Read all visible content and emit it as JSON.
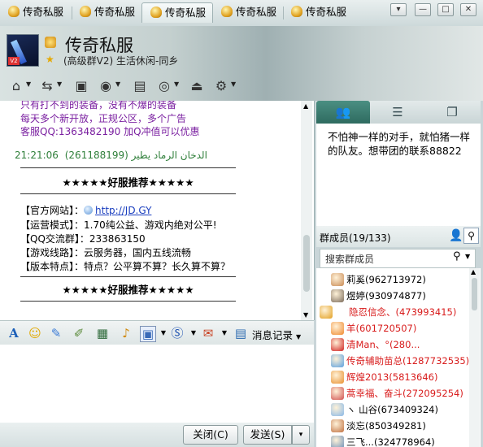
{
  "tabs": [
    {
      "label": "传奇私服",
      "active": false
    },
    {
      "label": "传奇私服",
      "active": false
    },
    {
      "label": "传奇私服",
      "active": true
    },
    {
      "label": "传奇私服",
      "active": false
    },
    {
      "label": "传奇私服",
      "active": false
    }
  ],
  "window": {
    "dropdown": "▾",
    "minimize": "—",
    "maximize": "□",
    "close": "✕"
  },
  "group": {
    "title": "传奇私服",
    "subtitle": "(高级群V2) 生活休闲-同乡",
    "avatar_badge": "V2"
  },
  "toolbar_icons": [
    "home-icon",
    "share-icon",
    "save-icon",
    "mic-icon",
    "board-icon",
    "webcam-icon",
    "shortcut-icon",
    "settings-icon"
  ],
  "chat": {
    "promo_lines": [
      "只有打不到的装备，没有不爆的装备",
      "每天多个新开放，正规公区，多个广告",
      "客服QQ:1363482190   加Q冲值可以优惠"
    ],
    "sender_name": "الدخان الرماد يطير",
    "sender_id": "(261188199)",
    "sender_time": "21:21:06",
    "banner": "★★★★★好服推荐★★★★★",
    "info": [
      {
        "label": "【官方网站】：",
        "value": "http://JD.GY",
        "link": true
      },
      {
        "label": "【运营模式】：",
        "value": "1.70纯公益、游戏内绝对公平!",
        "link": false
      },
      {
        "label": "【QQ交流群】：",
        "value": "233863150",
        "link": false
      },
      {
        "label": "【游戏线路】：",
        "value": "云服务器，国内五线流畅",
        "link": false
      },
      {
        "label": "【版本特点】：",
        "value": "特点？公平算不算？长久算不算？",
        "link": false
      }
    ],
    "banner2": "★★★★★好服推荐★★★★★"
  },
  "input_toolbar": {
    "msg_log": "消息记录"
  },
  "buttons": {
    "close": "关闭(C)",
    "send": "发送(S)",
    "send_arrow": "▾"
  },
  "right_tabs": [
    "members-tab",
    "list-tab",
    "window-tab"
  ],
  "notice": "不怕神一样的对手，就怕猪一样的队友。想带团的联系88822",
  "members": {
    "header": "群成员(19/133)",
    "search_placeholder": "搜索群成员",
    "list": [
      {
        "name": "莉奚(962713972)",
        "red": false,
        "av": "#c98a54"
      },
      {
        "name": "煜婷(930974877)",
        "red": false,
        "av": "#7a6a5a"
      },
      {
        "name": "隐忍信念、(473993415)",
        "red": true,
        "av": "#e2a020"
      },
      {
        "name": "羊(601720507)",
        "red": true,
        "av": "#f08a30"
      },
      {
        "name": "清Man、°(280...",
        "red": true,
        "av": "#d02020"
      },
      {
        "name": "传奇辅助苗总(1287732535)",
        "red": true,
        "av": "#5aa0e0"
      },
      {
        "name": "辉煌2013(5813646)",
        "red": true,
        "av": "#e89030"
      },
      {
        "name": "蒿幸福、奋斗(272095254)",
        "red": true,
        "av": "#d05050"
      },
      {
        "name": "ヽ 山谷(673409324)",
        "red": false,
        "av": "#88b8e8"
      },
      {
        "name": "淡忘(850349281)",
        "red": false,
        "av": "#c07040"
      },
      {
        "name": "三飞...(324778964)",
        "red": false,
        "av": "#6a8fb8"
      }
    ]
  }
}
